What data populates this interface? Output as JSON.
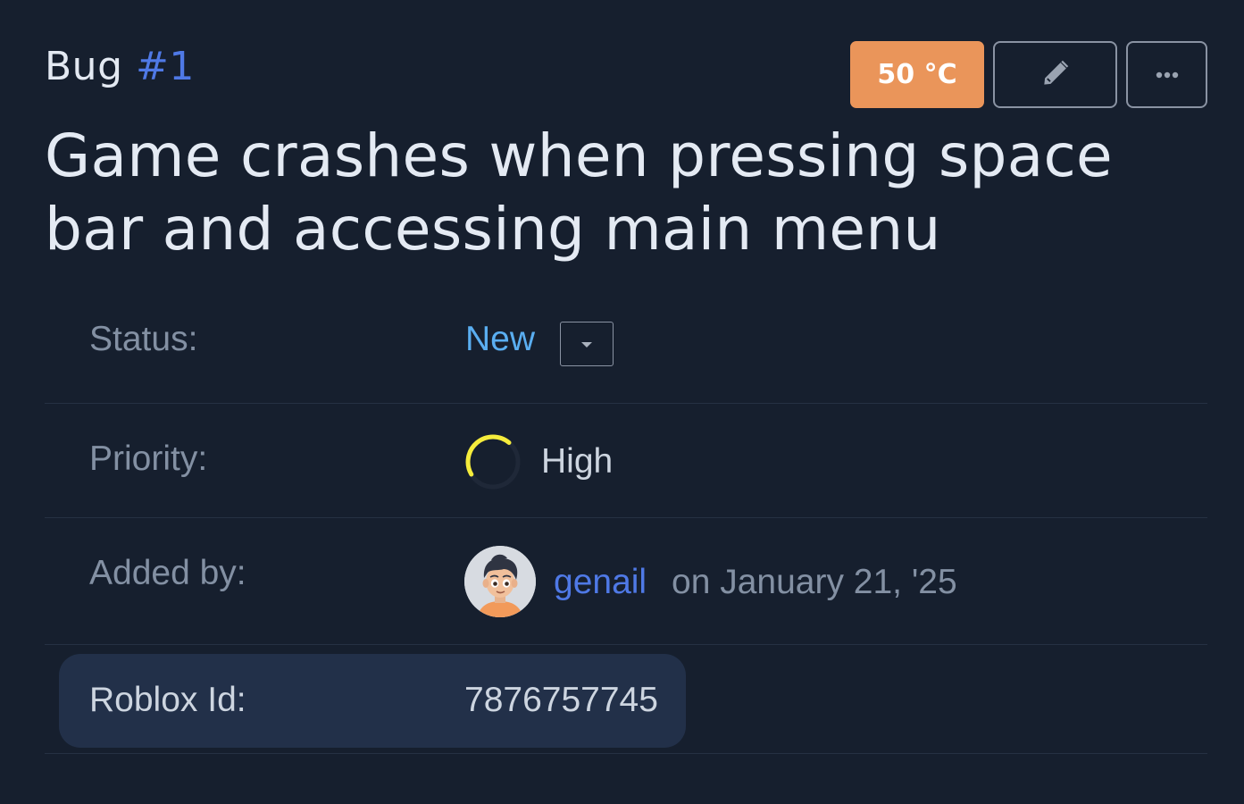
{
  "header": {
    "type_label": "Bug",
    "number": "#1",
    "temperature_badge": "50 °C"
  },
  "issue": {
    "title": "Game crashes when pressing space bar and accessing main menu"
  },
  "fields": {
    "status": {
      "label": "Status:",
      "value": "New"
    },
    "priority": {
      "label": "Priority:",
      "value": "High",
      "indicator_color": "#f5ec3c"
    },
    "added_by": {
      "label": "Added by:",
      "user": "genail",
      "date": "on January 21, '25"
    },
    "roblox_id": {
      "label": "Roblox Id:",
      "value": "7876757745"
    }
  },
  "icons": {
    "edit": "pencil-icon",
    "more": "ellipsis-icon",
    "dropdown": "caret-down-icon",
    "priority": "priority-ring-icon"
  },
  "colors": {
    "background": "#161f2e",
    "accent_blue": "#4f79e6",
    "status_blue": "#5aaef1",
    "badge_orange": "#ea955a",
    "highlight_row": "#223049"
  }
}
